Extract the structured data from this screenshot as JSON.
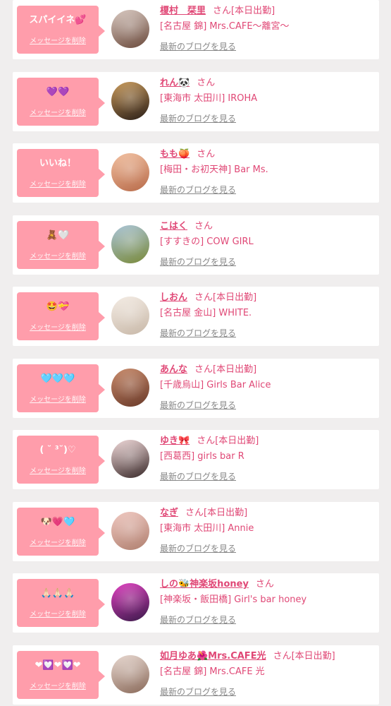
{
  "delete_label": "メッセージを削除",
  "blog_label": "最新のブログを見る",
  "san_label": "さん",
  "items": [
    {
      "message": "スパイイネ💕",
      "name": "榎村　栞里",
      "on_duty": "[本日出勤]",
      "shop": "[名古屋 錦] Mrs.CAFE〜離宮〜",
      "avatar_icon": "profile-photo",
      "avatar_colors": [
        "#d8c8c0",
        "#6b4a3c"
      ]
    },
    {
      "message": "💜💜",
      "name": "れん🐼",
      "on_duty": "",
      "shop": "[東海市 太田川] IROHA",
      "avatar_icon": "profile-photo",
      "avatar_colors": [
        "#c99a5a",
        "#2a1e18"
      ]
    },
    {
      "message": "いいね！",
      "name": "もも🍑",
      "on_duty": "",
      "shop": "[梅田・お初天神] Bar Ms.",
      "avatar_icon": "profile-photo",
      "avatar_colors": [
        "#f2c0a0",
        "#b86b4a"
      ]
    },
    {
      "message": "🧸🤍",
      "name": "こはく",
      "on_duty": "",
      "shop": "[すすきの] COW GIRL",
      "avatar_icon": "profile-photo",
      "avatar_colors": [
        "#a9c4d8",
        "#7a8a3a"
      ]
    },
    {
      "message": "🤩💝",
      "name": "しおん",
      "on_duty": "[本日出勤]",
      "shop": "[名古屋 金山] WHITE.",
      "avatar_icon": "profile-photo",
      "avatar_colors": [
        "#f4ece4",
        "#c8b8a8"
      ]
    },
    {
      "message": "🩵🩵🩵",
      "name": "あんな",
      "on_duty": "[本日出勤]",
      "shop": "[千歳烏山] Girls Bar Alice",
      "avatar_icon": "profile-photo",
      "avatar_colors": [
        "#c88a6a",
        "#6a3a2a"
      ]
    },
    {
      "message": "( ˘ ³˘)♡",
      "name": "ゆき🎀",
      "on_duty": "[本日出勤]",
      "shop": "[西葛西] girls bar R",
      "avatar_icon": "profile-photo",
      "avatar_colors": [
        "#f0d8d8",
        "#3a2a2a"
      ]
    },
    {
      "message": "🐶💗🩵",
      "name": "なぎ",
      "on_duty": "[本日出勤]",
      "shop": "[東海市 太田川] Annie",
      "avatar_icon": "profile-photo",
      "avatar_colors": [
        "#f0c8c0",
        "#b08070"
      ]
    },
    {
      "message": "🙏🏻🙏🏻🙏🏻",
      "name": "しの🐝神楽坂honey",
      "on_duty": "",
      "shop": "[神楽坂・飯田橋] Girl's bar honey",
      "avatar_icon": "profile-photo",
      "avatar_colors": [
        "#e040c0",
        "#3a1a4a"
      ]
    },
    {
      "message": "❤︎💟❤︎💟❤︎",
      "name": "如月ゆあ🌺Mrs.CAFE光",
      "on_duty": "[本日出勤]",
      "shop": "[名古屋 錦] Mrs.CAFE 光",
      "avatar_icon": "profile-photo",
      "avatar_colors": [
        "#e8d8d0",
        "#8a6a5a"
      ]
    }
  ]
}
